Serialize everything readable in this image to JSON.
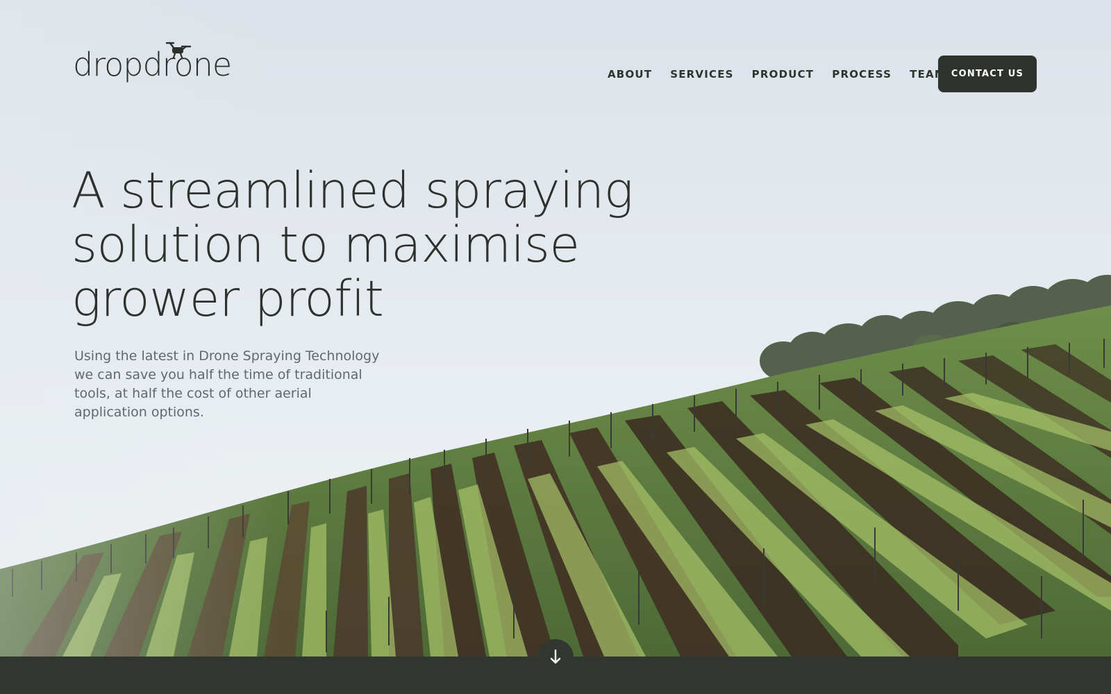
{
  "brand": {
    "logo_text": "dropdrone",
    "logo_icon": "drone-icon"
  },
  "nav": {
    "items": [
      {
        "label": "ABOUT"
      },
      {
        "label": "SERVICES"
      },
      {
        "label": "PRODUCT"
      },
      {
        "label": "PROCESS"
      },
      {
        "label": "TEAM"
      }
    ],
    "cta_label": "CONTACT US"
  },
  "hero": {
    "title_lines": [
      "A streamlined spraying",
      "solution to maximise",
      "grower profit"
    ],
    "subtitle": "Using the latest in Drone Spraying Technology we can save you half the time of traditional tools, at half the cost of other aerial application options.",
    "background": "vineyard-hillside-photo"
  },
  "scroll_indicator": {
    "icon": "arrow-down-icon"
  },
  "colors": {
    "dark": "#313630",
    "text": "#2d322e",
    "muted_text": "#5e6a70",
    "sky_top": "#dce2e9",
    "foliage": "#6f9a3f"
  }
}
